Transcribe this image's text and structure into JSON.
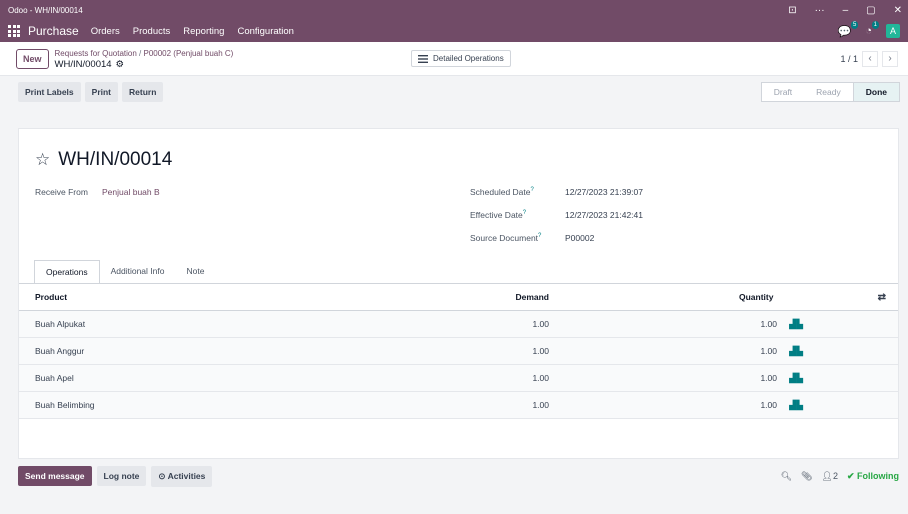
{
  "window": {
    "title": "Odoo - WH/IN/00014",
    "controls": [
      "⊡",
      "···",
      "–",
      "▢",
      "✕"
    ]
  },
  "navbar": {
    "brand": "Purchase",
    "menu": [
      "Orders",
      "Products",
      "Reporting",
      "Configuration"
    ],
    "messages_badge": "5",
    "activities_badge": "1",
    "avatar_letter": "A"
  },
  "control": {
    "new_label": "New",
    "breadcrumb_parent": "Requests for Quotation",
    "breadcrumb_sep": "/",
    "breadcrumb_record": "P00002 (Penjual buah C)",
    "current": "WH/IN/00014",
    "detailed_ops_label": "Detailed Operations",
    "pager": "1 / 1"
  },
  "actions": {
    "print_labels": "Print Labels",
    "print": "Print",
    "return": "Return"
  },
  "statusbar": {
    "stages": [
      "Draft",
      "Ready",
      "Done"
    ],
    "active": "Done"
  },
  "record": {
    "title": "WH/IN/00014",
    "receive_from_label": "Receive From",
    "receive_from_value": "Penjual buah B",
    "scheduled_date_label": "Scheduled Date",
    "scheduled_date_value": "12/27/2023 21:39:07",
    "effective_date_label": "Effective Date",
    "effective_date_value": "12/27/2023 21:42:41",
    "source_document_label": "Source Document",
    "source_document_value": "P00002",
    "help_mark": "?"
  },
  "tabs": [
    "Operations",
    "Additional Info",
    "Note"
  ],
  "table": {
    "headers": {
      "product": "Product",
      "demand": "Demand",
      "quantity": "Quantity"
    },
    "rows": [
      {
        "product": "Buah Alpukat",
        "demand": "1.00",
        "quantity": "1.00"
      },
      {
        "product": "Buah Anggur",
        "demand": "1.00",
        "quantity": "1.00"
      },
      {
        "product": "Buah Apel",
        "demand": "1.00",
        "quantity": "1.00"
      },
      {
        "product": "Buah Belimbing",
        "demand": "1.00",
        "quantity": "1.00"
      }
    ]
  },
  "chatter": {
    "send_message": "Send message",
    "log_note": "Log note",
    "activities": "Activities",
    "followers_count": "2",
    "following": "Following"
  },
  "colors": {
    "brand": "#714b67",
    "accent": "#017e84",
    "success": "#28a745"
  }
}
